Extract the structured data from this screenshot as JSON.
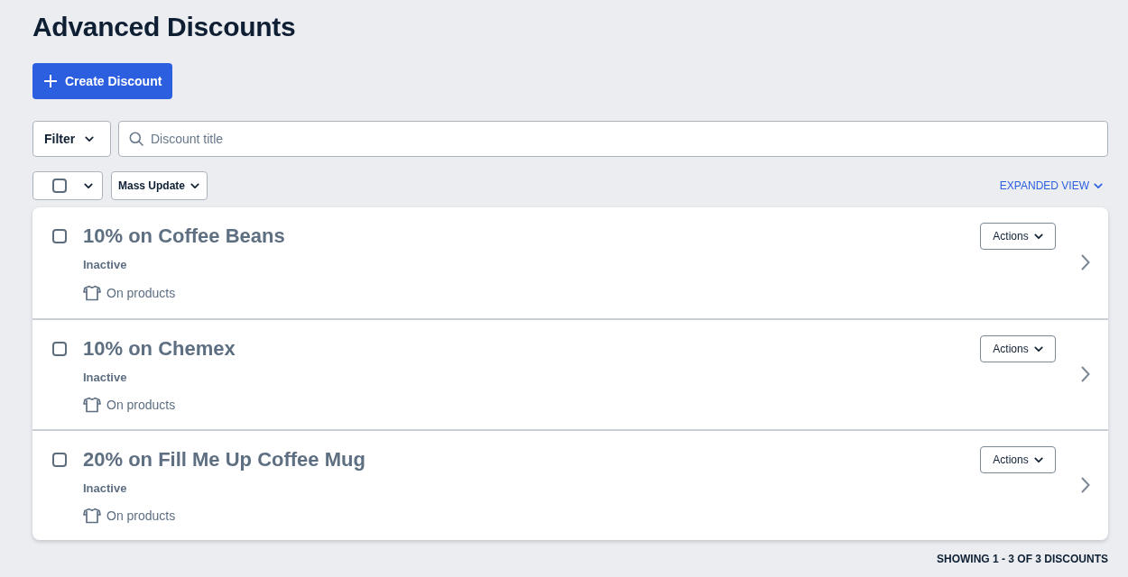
{
  "page": {
    "title": "Advanced Discounts"
  },
  "create_button": {
    "label": "Create Discount"
  },
  "filter": {
    "label": "Filter"
  },
  "search": {
    "placeholder": "Discount title"
  },
  "bulk": {
    "select_all": {
      "checked": false
    },
    "mass_update": {
      "label": "Mass Update"
    }
  },
  "view_toggle": {
    "label": "EXPANDED VIEW"
  },
  "discounts": [
    {
      "title": "10% on Coffee Beans",
      "status": "Inactive",
      "scope": "On products",
      "checked": false,
      "actions_label": "Actions"
    },
    {
      "title": "10% on Chemex",
      "status": "Inactive",
      "scope": "On products",
      "checked": false,
      "actions_label": "Actions"
    },
    {
      "title": "20% on Fill Me Up Coffee Mug",
      "status": "Inactive",
      "scope": "On products",
      "checked": false,
      "actions_label": "Actions"
    }
  ],
  "footer": {
    "summary": "SHOWING 1 - 3 OF 3 DISCOUNTS"
  }
}
